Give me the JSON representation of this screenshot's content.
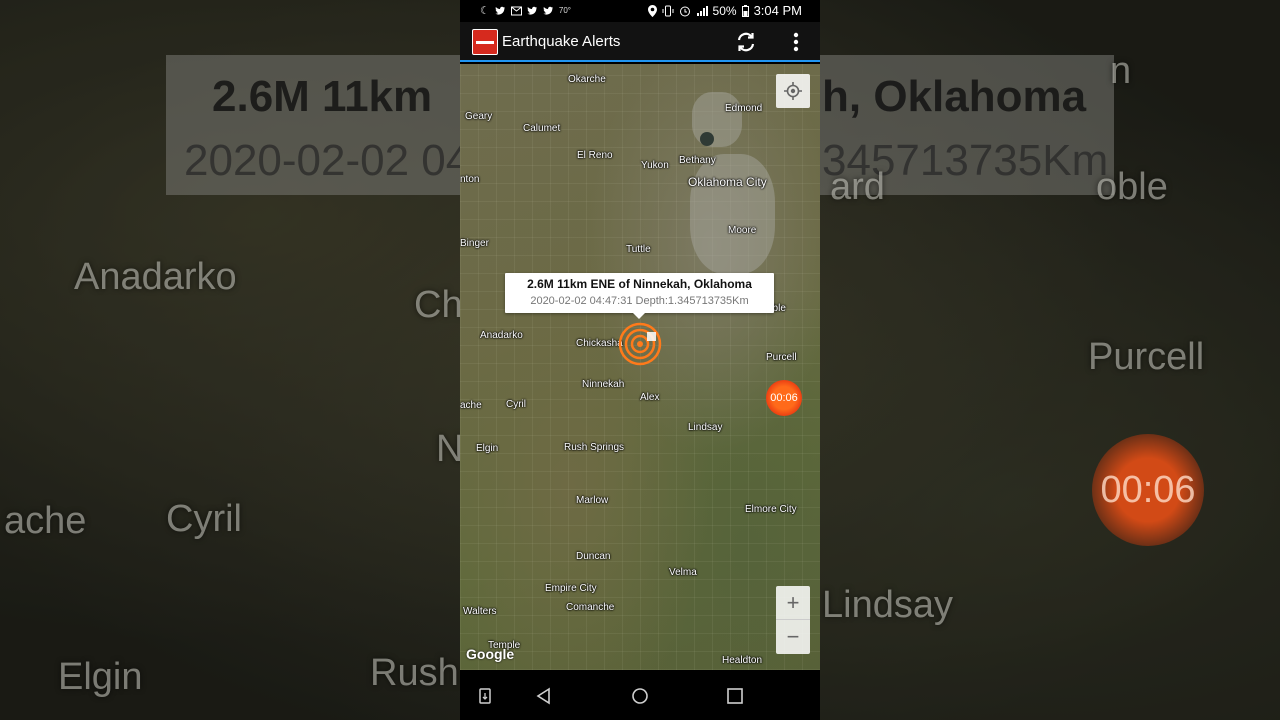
{
  "background": {
    "banner_title": "2.6M  11km ENE of Ninnekah, Oklahoma",
    "banner_title_left": "2.6M  11km",
    "banner_title_right": "h, Oklahoma",
    "banner_sub_left": "2020-02-02 04",
    "banner_sub_right": "345713735Km",
    "places": [
      "Anadarko",
      "Ch",
      "ache",
      "Cyril",
      "N",
      "Elgin",
      "Rush",
      "Purcell",
      "oble",
      "Lindsay",
      "ard",
      "n"
    ],
    "timer": "00:06"
  },
  "statusbar": {
    "temperature": "70°",
    "battery": "50%",
    "time": "3:04 PM"
  },
  "appbar": {
    "title": "Earthquake Alerts"
  },
  "map": {
    "places": {
      "okarche": "Okarche",
      "edmond": "Edmond",
      "geary": "Geary",
      "calumet": "Calumet",
      "el_reno": "El Reno",
      "yukon": "Yukon",
      "bethany": "Bethany",
      "oklahoma_city": "Oklahoma City",
      "nton": "nton",
      "moore": "Moore",
      "binger": "Binger",
      "tuttle": "Tuttle",
      "anadarko": "Anadarko",
      "chickasha": "Chickasha",
      "purcell": "Purcell",
      "ninnekah": "Ninnekah",
      "ache": "ache",
      "cyril": "Cyril",
      "alex": "Alex",
      "lindsay": "Lindsay",
      "elgin": "Elgin",
      "rush_springs": "Rush Springs",
      "marlow": "Marlow",
      "elmore_city": "Elmore City",
      "duncan": "Duncan",
      "velma": "Velma",
      "empire_city": "Empire City",
      "comanche": "Comanche",
      "walters": "Walters",
      "temple": "Temple",
      "healdton": "Healdton",
      "oble": "oble"
    },
    "infowindow": {
      "title": "2.6M  11km ENE of Ninnekah, Oklahoma",
      "subtitle": "2020-02-02 04:47:31 Depth:1.345713735Km"
    },
    "timer_badge": "00:06",
    "zoom_in": "+",
    "zoom_out": "−",
    "attribution": "Google"
  },
  "colors": {
    "accent": "#2196f3",
    "logo_red": "#d62a1e",
    "quake_orange": "#ff7a1a"
  },
  "icons": [
    "moon-icon",
    "twitter-icon",
    "mail-icon",
    "location-icon",
    "vibrate-icon",
    "alarm-icon",
    "signal-icon",
    "battery-icon",
    "refresh-icon",
    "more-vert-icon",
    "my-location-icon",
    "quake-marker-icon",
    "back-icon",
    "home-icon",
    "recents-icon",
    "notification-icon"
  ]
}
